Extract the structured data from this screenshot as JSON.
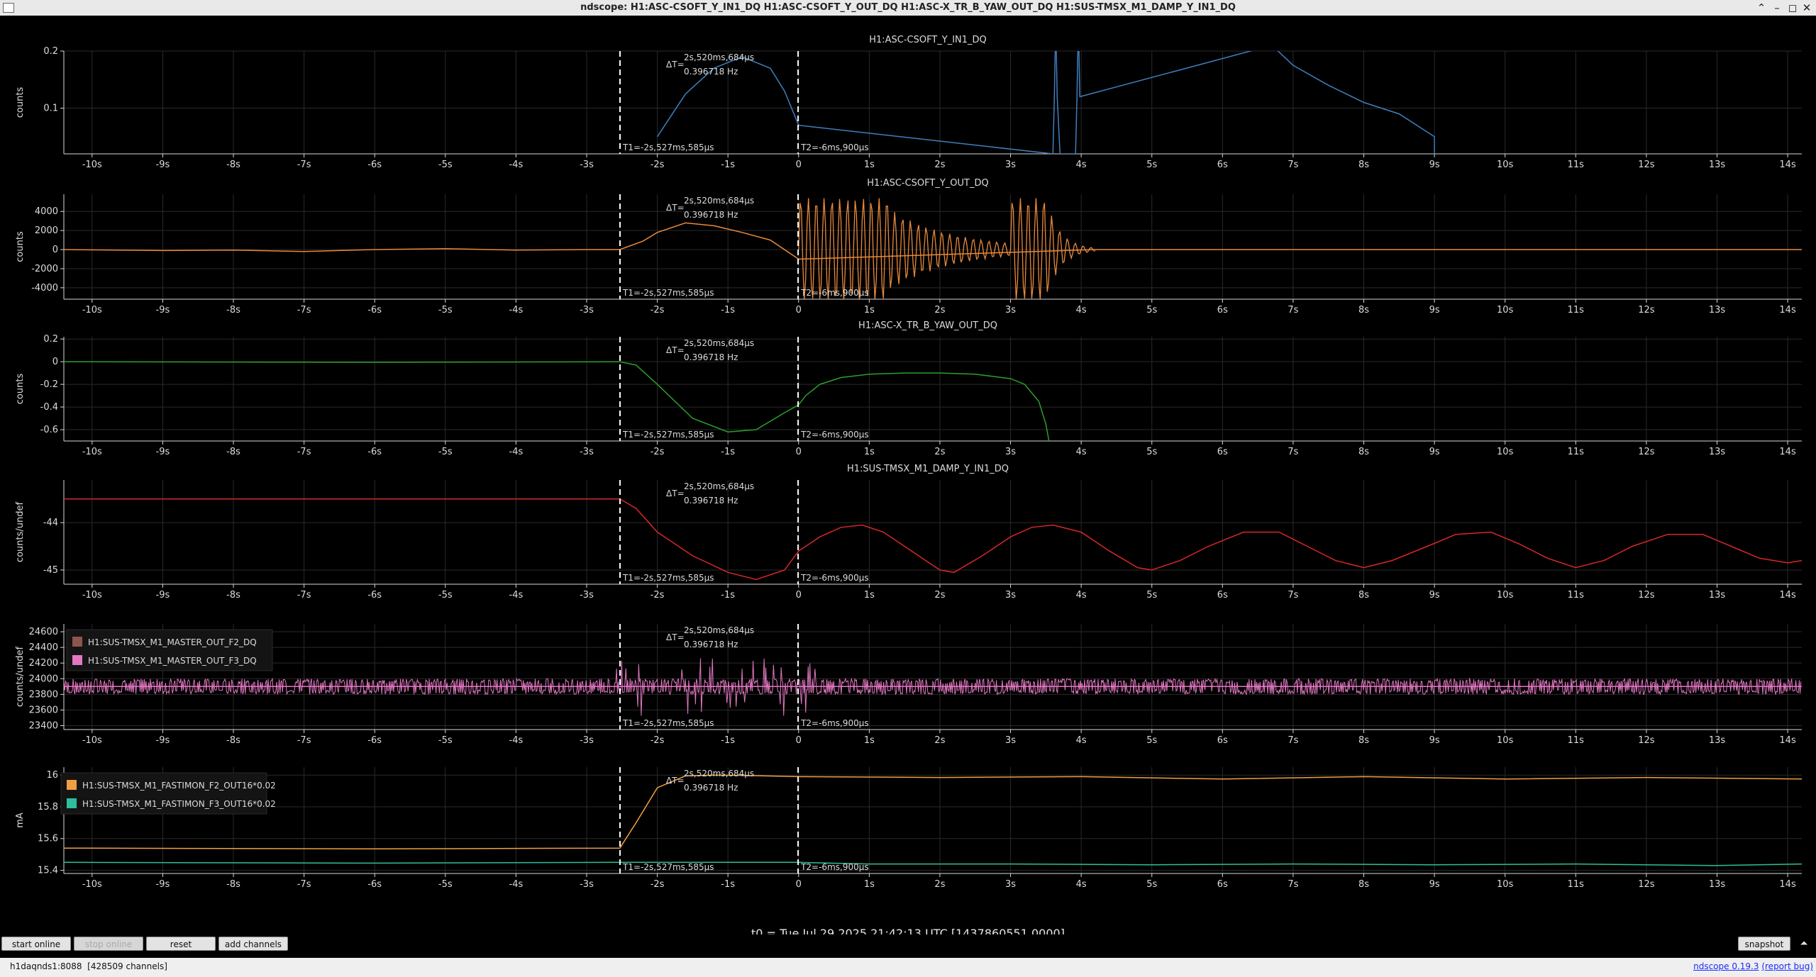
{
  "window": {
    "title": "ndscope: H1:ASC-CSOFT_Y_IN1_DQ H1:ASC-CSOFT_Y_OUT_DQ H1:ASC-X_TR_B_YAW_OUT_DQ H1:SUS-TMSX_M1_DAMP_Y_IN1_DQ",
    "min_glyph": "⌃",
    "minimize_glyph": "–",
    "maximize_glyph": "◻",
    "close_glyph": "✕"
  },
  "cursors": {
    "t1_label": "T1=-2s,527ms,585µs",
    "t2_label": "T2=-6ms,900µs",
    "delta_prefix": "ΔT=",
    "delta_value": "2s,520ms,684µs",
    "delta_freq": "0.396718 Hz",
    "t1_value_s": -2.527585,
    "t2_value_s": -0.0069
  },
  "x_axis": {
    "min_s": -10.4,
    "max_s": 14.2,
    "ticks": [
      -10,
      -9,
      -8,
      -7,
      -6,
      -5,
      -4,
      -3,
      -2,
      -1,
      0,
      1,
      2,
      3,
      4,
      5,
      6,
      7,
      8,
      9,
      10,
      11,
      12,
      13,
      14
    ],
    "tick_labels": [
      "-10s",
      "-9s",
      "-8s",
      "-7s",
      "-6s",
      "-5s",
      "-4s",
      "-3s",
      "-2s",
      "-1s",
      "0",
      "1s",
      "2s",
      "3s",
      "4s",
      "5s",
      "6s",
      "7s",
      "8s",
      "9s",
      "10s",
      "11s",
      "12s",
      "13s",
      "14s"
    ]
  },
  "chart_data": [
    {
      "type": "line",
      "title": "H1:ASC-CSOFT_Y_IN1_DQ",
      "ylabel": "counts",
      "ylim": [
        0.02,
        0.2
      ],
      "yticks": [
        0.1,
        0.2
      ],
      "ytick_labels": [
        "0.1",
        "0.2"
      ],
      "series": [
        {
          "color": "#3f7fbf",
          "x": [
            -2.0,
            -1.6,
            -1.2,
            -0.8,
            -0.4,
            -0.2,
            0.0,
            3.6,
            3.62,
            3.64,
            3.66,
            3.7,
            3.92,
            3.94,
            3.96,
            3.98,
            6.7,
            7.0,
            7.5,
            8.0,
            8.5,
            9.0,
            9.0
          ],
          "y": [
            0.05,
            0.125,
            0.17,
            0.19,
            0.17,
            0.13,
            0.07,
            0.02,
            0.12,
            0.25,
            0.12,
            0.02,
            0.02,
            0.12,
            0.25,
            0.12,
            0.21,
            0.175,
            0.14,
            0.11,
            0.09,
            0.05,
            0.02
          ]
        }
      ]
    },
    {
      "type": "line",
      "title": "H1:ASC-CSOFT_Y_OUT_DQ",
      "ylabel": "counts",
      "ylim": [
        -5200,
        5800
      ],
      "yticks": [
        -4000,
        -2000,
        0,
        2000,
        4000
      ],
      "ytick_labels": [
        "-4000",
        "-2000",
        "0",
        "2000",
        "4000"
      ],
      "series": [
        {
          "color": "#e8893b",
          "x": [
            -10.4,
            -9,
            -8,
            -7,
            -6,
            -5,
            -4,
            -3,
            -2.53,
            -2.2,
            -2.0,
            -1.6,
            -1.2,
            -0.8,
            -0.4,
            -0.1,
            0.0,
            4.2,
            14.2
          ],
          "y": [
            0,
            -100,
            -50,
            -200,
            0,
            100,
            -50,
            0,
            0,
            900,
            1800,
            2800,
            2500,
            1800,
            1000,
            -500,
            -1000,
            0,
            0
          ]
        }
      ]
    },
    {
      "type": "line",
      "title": "H1:ASC-X_TR_B_YAW_OUT_DQ",
      "ylabel": "counts",
      "ylim": [
        -0.7,
        0.22
      ],
      "yticks": [
        -0.6,
        -0.4,
        -0.2,
        0,
        0.2
      ],
      "ytick_labels": [
        "-0.6",
        "-0.4",
        "-0.2",
        "0",
        "0.2"
      ],
      "series": [
        {
          "color": "#2ca02c",
          "x": [
            -10.4,
            -6,
            -2.53,
            -2.3,
            -2.0,
            -1.5,
            -1.0,
            -0.6,
            -0.2,
            0.0,
            0.1,
            0.3,
            0.6,
            1.0,
            1.5,
            2.0,
            2.5,
            3.0,
            3.2,
            3.4,
            3.5,
            3.55
          ],
          "y": [
            0,
            -0.005,
            0,
            -0.03,
            -0.2,
            -0.5,
            -0.62,
            -0.6,
            -0.45,
            -0.38,
            -0.3,
            -0.2,
            -0.14,
            -0.11,
            -0.1,
            -0.1,
            -0.11,
            -0.15,
            -0.2,
            -0.35,
            -0.55,
            -0.72
          ]
        }
      ]
    },
    {
      "type": "line",
      "title": "H1:SUS-TMSX_M1_DAMP_Y_IN1_DQ",
      "ylabel": "counts/undef",
      "ylim": [
        -45.3,
        -43.1
      ],
      "yticks": [
        -45,
        -44
      ],
      "ytick_labels": [
        "-45",
        "-44"
      ],
      "series": [
        {
          "color": "#d62728",
          "x": [
            -10.4,
            -2.53,
            -2.3,
            -2.0,
            -1.5,
            -1.0,
            -0.6,
            -0.2,
            0.0,
            0.3,
            0.6,
            0.9,
            1.2,
            1.6,
            2.0,
            2.2,
            2.6,
            3.0,
            3.3,
            3.6,
            4.0,
            4.4,
            4.8,
            5.0,
            5.4,
            5.8,
            6.3,
            6.8,
            7.2,
            7.6,
            8.0,
            8.4,
            8.9,
            9.3,
            9.8,
            10.2,
            10.6,
            11.0,
            11.4,
            11.8,
            12.3,
            12.8,
            13.2,
            13.6,
            14.0,
            14.2
          ],
          "y": [
            -43.5,
            -43.5,
            -43.7,
            -44.2,
            -44.7,
            -45.05,
            -45.2,
            -45.0,
            -44.6,
            -44.3,
            -44.1,
            -44.05,
            -44.2,
            -44.6,
            -45.0,
            -45.05,
            -44.7,
            -44.3,
            -44.1,
            -44.05,
            -44.2,
            -44.6,
            -44.95,
            -45.0,
            -44.8,
            -44.5,
            -44.2,
            -44.2,
            -44.5,
            -44.8,
            -44.95,
            -44.8,
            -44.5,
            -44.25,
            -44.2,
            -44.45,
            -44.75,
            -44.95,
            -44.8,
            -44.5,
            -44.25,
            -44.25,
            -44.5,
            -44.75,
            -44.85,
            -44.8
          ]
        }
      ]
    },
    {
      "type": "line",
      "ylabel": "counts/undef",
      "ylim": [
        23350,
        24700
      ],
      "yticks": [
        23400,
        23600,
        23800,
        24000,
        24200,
        24400,
        24600
      ],
      "ytick_labels": [
        "23400",
        "23600",
        "23800",
        "24000",
        "24200",
        "24400",
        "24600"
      ],
      "legend_position": "top-left",
      "series": [
        {
          "name": "H1:SUS-TMSX_M1_MASTER_OUT_F2_DQ",
          "color": "#8c564b",
          "x": [
            -10.4,
            14.2
          ],
          "y": [
            23900,
            23900
          ]
        },
        {
          "name": "H1:SUS-TMSX_M1_MASTER_OUT_F3_DQ",
          "color": "#e377c2",
          "x": [
            -10.4,
            14.2
          ],
          "y": [
            23900,
            23900
          ]
        }
      ]
    },
    {
      "type": "line",
      "ylabel": "mA",
      "ylim": [
        15.38,
        16.05
      ],
      "yticks": [
        15.4,
        15.6,
        15.8,
        16
      ],
      "ytick_labels": [
        "15.4",
        "15.6",
        "15.8",
        "16"
      ],
      "legend_position": "top-left",
      "series": [
        {
          "name": "H1:SUS-TMSX_M1_FASTIMON_F2_OUT16*0.02",
          "color": "#f0a040",
          "x": [
            -10.4,
            -6,
            -2.53,
            -2.3,
            -2.0,
            -1.6,
            -1.2,
            -0.8,
            0.0,
            2,
            4,
            6,
            8,
            10,
            12,
            14.2
          ],
          "y": [
            15.54,
            15.535,
            15.54,
            15.7,
            15.92,
            15.995,
            16.0,
            15.998,
            15.99,
            15.985,
            15.99,
            15.975,
            15.99,
            15.975,
            15.985,
            15.975
          ]
        },
        {
          "name": "H1:SUS-TMSX_M1_FASTIMON_F3_OUT16*0.02",
          "color": "#2dbf9a",
          "x": [
            -10.4,
            -6,
            -2.53,
            -2.0,
            0.0,
            1,
            3,
            5,
            7,
            9,
            11,
            13,
            14.2
          ],
          "y": [
            15.45,
            15.445,
            15.45,
            15.45,
            15.45,
            15.44,
            15.44,
            15.435,
            15.44,
            15.435,
            15.44,
            15.43,
            15.44
          ]
        }
      ]
    }
  ],
  "t0_label": "t0 = Tue Jul 29 2025 21:42:13 UTC [1437860551.0000]",
  "toolbar": {
    "start_online": "start online",
    "stop_online": "stop online",
    "reset": "reset",
    "add_channels": "add channels",
    "snapshot": "snapshot",
    "expand_glyph": "⏶"
  },
  "status": {
    "server": "h1daqnds1:8088",
    "channels": "[428509 channels]",
    "version_link": "ndscope 0.19.3",
    "report_bug": "(report bug)"
  },
  "colors": {
    "background": "#000000",
    "grid": "#2a2a2a",
    "axis": "#d8d8d8",
    "cursor": "#ffffff"
  }
}
